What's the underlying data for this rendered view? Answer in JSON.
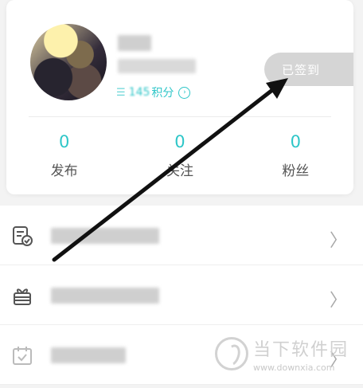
{
  "profile": {
    "points_icon": "coin-icon",
    "points_value": "145",
    "points_unit": "积分",
    "sign_in_label": "已签到"
  },
  "stats": [
    {
      "value": "0",
      "label": "发布"
    },
    {
      "value": "0",
      "label": "关注"
    },
    {
      "value": "0",
      "label": "粉丝"
    }
  ],
  "menu": [
    {
      "icon": "task-list-icon"
    },
    {
      "icon": "gift-icon"
    },
    {
      "icon": "calendar-icon"
    }
  ],
  "annotation": {
    "type": "black-arrow",
    "target": "sign-in-button"
  },
  "watermark": {
    "brand": "当下软件园",
    "url": "www.downxia.com"
  },
  "colors": {
    "accent": "#2ec6c8",
    "sign_in_bg": "#d5d5d5",
    "background": "#f3f3f3"
  }
}
